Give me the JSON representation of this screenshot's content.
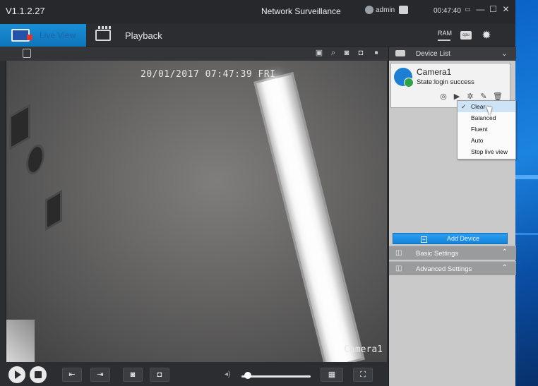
{
  "title_bar": {
    "version": "V1.1.2.27",
    "app_title": "Network Surveillance",
    "user": "admin",
    "clock": "00:47:40",
    "minimize_glyph": "—",
    "maximize_glyph": "☐",
    "close_glyph": "✕"
  },
  "toolbar": {
    "live_view_label": "Live View",
    "playback_label": "Playback",
    "ram_label": "RAM",
    "cpu_label": "cpu"
  },
  "video": {
    "osd_timestamp": "20/01/2017 07:47:39 FRI",
    "osd_camera": "Camera1"
  },
  "controls": {
    "volume_level": 0.05
  },
  "panel": {
    "device_list_label": "Device List",
    "device": {
      "name": "Camera1",
      "state": "State:login success"
    },
    "add_device_label": "Add Device",
    "sections": [
      {
        "label": "Basic Settings"
      },
      {
        "label": "Advanced Settings"
      }
    ]
  },
  "stream_menu": {
    "items": [
      {
        "label": "Clear",
        "checked": true
      },
      {
        "label": "Balanced"
      },
      {
        "label": "Fluent"
      },
      {
        "label": "Auto"
      },
      {
        "label": "Stop live view"
      }
    ]
  },
  "icons": {
    "desktop_accent": "#1b84e0",
    "live_tab_color": "#1a8fd6"
  }
}
